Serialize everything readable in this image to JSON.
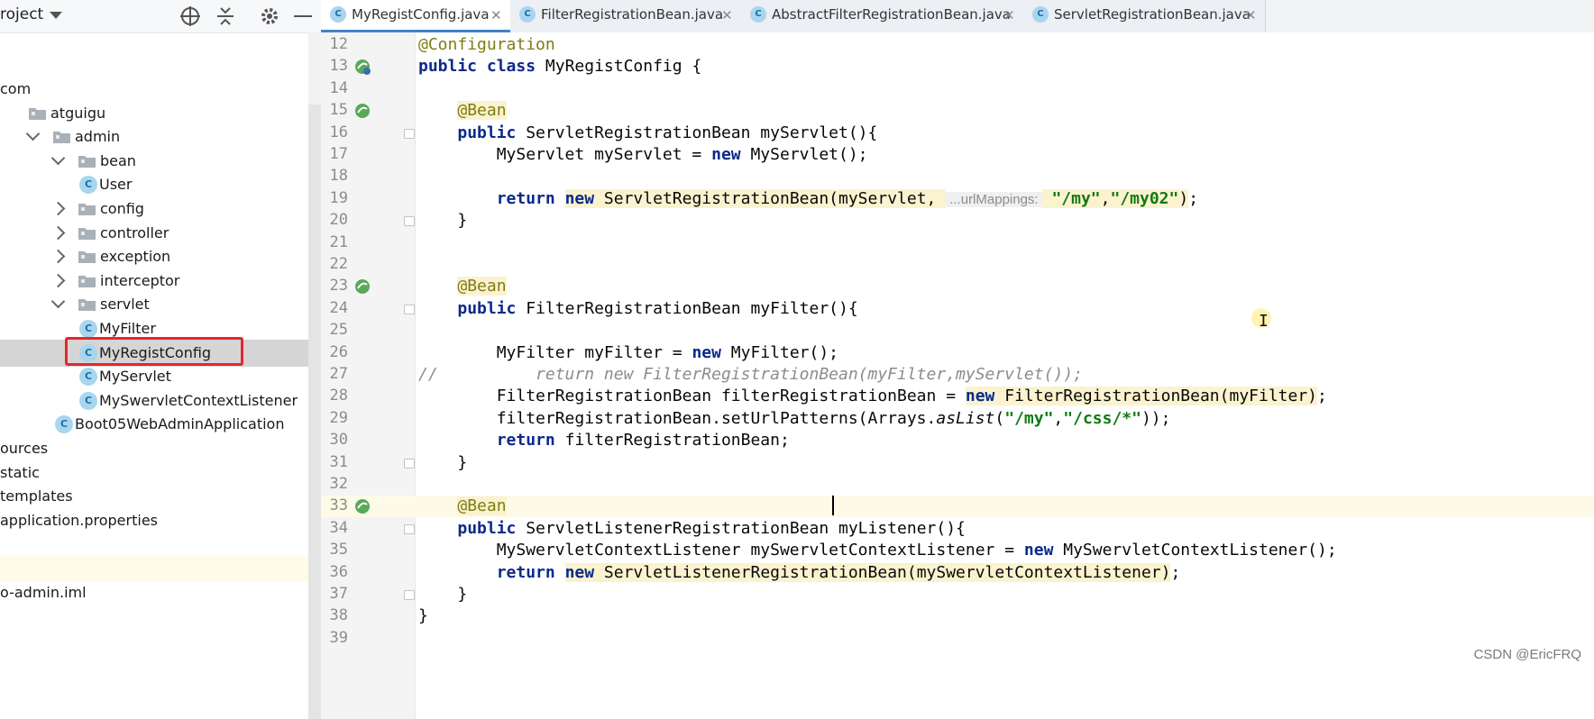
{
  "project_panel": {
    "title": "roject",
    "tree": [
      {
        "label": "com",
        "type": "text",
        "indent": 0
      },
      {
        "label": "atguigu",
        "type": "folder",
        "indent": 1
      },
      {
        "label": "admin",
        "type": "folder",
        "indent": 2,
        "expanded": true
      },
      {
        "label": "bean",
        "type": "folder",
        "indent": 3,
        "expanded": true
      },
      {
        "label": "User",
        "type": "class",
        "indent": 4
      },
      {
        "label": "config",
        "type": "folder",
        "indent": 3,
        "expanded": false
      },
      {
        "label": "controller",
        "type": "folder",
        "indent": 3,
        "expanded": false
      },
      {
        "label": "exception",
        "type": "folder",
        "indent": 3,
        "expanded": false
      },
      {
        "label": "interceptor",
        "type": "folder",
        "indent": 3,
        "expanded": false
      },
      {
        "label": "servlet",
        "type": "folder",
        "indent": 3,
        "expanded": true
      },
      {
        "label": "MyFilter",
        "type": "class",
        "indent": 4
      },
      {
        "label": "MyRegistConfig",
        "type": "class",
        "indent": 4,
        "selected": true
      },
      {
        "label": "MyServlet",
        "type": "class",
        "indent": 4
      },
      {
        "label": "MySwervletContextListener",
        "type": "class",
        "indent": 4
      },
      {
        "label": "Boot05WebAdminApplication",
        "type": "app",
        "indent": 3
      },
      {
        "label": "ources",
        "type": "text",
        "indent": 0
      },
      {
        "label": "static",
        "type": "text",
        "indent": 0
      },
      {
        "label": "templates",
        "type": "text",
        "indent": 0
      },
      {
        "label": "application.properties",
        "type": "text",
        "indent": 0
      },
      {
        "label": "",
        "type": "blank",
        "indent": 0
      },
      {
        "label": "",
        "type": "highlight",
        "indent": 0
      },
      {
        "label": "o-admin.iml",
        "type": "text",
        "indent": 0
      }
    ]
  },
  "tabs": [
    {
      "label": "MyRegistConfig.java",
      "active": true
    },
    {
      "label": "FilterRegistrationBean.java",
      "active": false
    },
    {
      "label": "AbstractFilterRegistrationBean.java",
      "active": false
    },
    {
      "label": "ServletRegistrationBean.java",
      "active": false
    }
  ],
  "editor": {
    "lines": [
      {
        "n": "12",
        "segs": [
          [
            "ann",
            "@Configuration"
          ]
        ]
      },
      {
        "n": "13",
        "icon": "bean-config",
        "segs": [
          [
            "kw",
            "public class "
          ],
          [
            "",
            "MyRegistConfig {"
          ]
        ]
      },
      {
        "n": "14",
        "segs": []
      },
      {
        "n": "15",
        "icon": "bean",
        "segs": [
          [
            "",
            "    "
          ],
          [
            "annbg",
            "@Bean"
          ]
        ]
      },
      {
        "n": "16",
        "fold": true,
        "segs": [
          [
            "",
            "    "
          ],
          [
            "kw",
            "public "
          ],
          [
            "",
            "ServletRegistrationBean myServlet(){"
          ]
        ]
      },
      {
        "n": "17",
        "segs": [
          [
            "",
            "        MyServlet myServlet = "
          ],
          [
            "kw",
            "new "
          ],
          [
            "",
            "MyServlet();"
          ]
        ]
      },
      {
        "n": "18",
        "segs": []
      },
      {
        "n": "19",
        "segs": [
          [
            "",
            "        "
          ],
          [
            "kw",
            "return "
          ],
          [
            "kwbg",
            "new "
          ],
          [
            "hlbg",
            "ServletRegistrationBean(myServlet, "
          ],
          [
            "hint",
            "...urlMappings:"
          ],
          [
            "hlbg",
            " "
          ],
          [
            "strbg",
            "\"/my\""
          ],
          [
            "hlbg",
            ","
          ],
          [
            "strbg",
            "\"/my02\""
          ],
          [
            "hlbg",
            ")"
          ],
          [
            "",
            ";"
          ]
        ]
      },
      {
        "n": "20",
        "fold": true,
        "segs": [
          [
            "",
            "    }"
          ]
        ]
      },
      {
        "n": "21",
        "segs": []
      },
      {
        "n": "22",
        "segs": []
      },
      {
        "n": "23",
        "icon": "bean",
        "segs": [
          [
            "",
            "    "
          ],
          [
            "annbg",
            "@Bean"
          ]
        ]
      },
      {
        "n": "24",
        "fold": true,
        "segs": [
          [
            "",
            "    "
          ],
          [
            "kw",
            "public "
          ],
          [
            "",
            "FilterRegistrationBean myFilter(){"
          ]
        ]
      },
      {
        "n": "25",
        "segs": []
      },
      {
        "n": "26",
        "segs": [
          [
            "",
            "        MyFilter myFilter = "
          ],
          [
            "kw",
            "new "
          ],
          [
            "",
            "MyFilter();"
          ]
        ]
      },
      {
        "n": "27",
        "segs": [
          [
            "cmt",
            "//          return new FilterRegistrationBean(myFilter,myServlet());"
          ]
        ]
      },
      {
        "n": "28",
        "segs": [
          [
            "",
            "        FilterRegistrationBean filterRegistrationBean = "
          ],
          [
            "kwbg",
            "new "
          ],
          [
            "hlbg",
            "FilterRegistrationBean(myFilter)"
          ],
          [
            "",
            ";"
          ]
        ]
      },
      {
        "n": "29",
        "segs": [
          [
            "",
            "        filterRegistrationBean.setUrlPatterns(Arrays."
          ],
          [
            "it",
            "asList"
          ],
          [
            "",
            "("
          ],
          [
            "str",
            "\"/my\""
          ],
          [
            "",
            ","
          ],
          [
            "str",
            "\"/css/*\""
          ],
          [
            "",
            "));"
          ]
        ]
      },
      {
        "n": "30",
        "segs": [
          [
            "",
            "        "
          ],
          [
            "kw",
            "return "
          ],
          [
            "",
            "filterRegistrationBean;"
          ]
        ]
      },
      {
        "n": "31",
        "fold": true,
        "segs": [
          [
            "",
            "    }"
          ]
        ]
      },
      {
        "n": "32",
        "segs": []
      },
      {
        "n": "33",
        "icon": "bean",
        "current": true,
        "segs": [
          [
            "",
            "    "
          ],
          [
            "annbg",
            "@Bean"
          ]
        ]
      },
      {
        "n": "34",
        "fold": true,
        "segs": [
          [
            "",
            "    "
          ],
          [
            "kw",
            "public "
          ],
          [
            "",
            "ServletListenerRegistrationBean myListener(){"
          ]
        ]
      },
      {
        "n": "35",
        "segs": [
          [
            "",
            "        MySwervletContextListener mySwervletContextListener = "
          ],
          [
            "kw",
            "new "
          ],
          [
            "",
            "MySwervletContextListener();"
          ]
        ]
      },
      {
        "n": "36",
        "segs": [
          [
            "",
            "        "
          ],
          [
            "kw",
            "return "
          ],
          [
            "kwbg",
            "new "
          ],
          [
            "hlbg",
            "ServletListenerRegistrationBean(mySwervletContextListener)"
          ],
          [
            "",
            ";"
          ]
        ]
      },
      {
        "n": "37",
        "fold": true,
        "segs": [
          [
            "",
            "    }"
          ]
        ]
      },
      {
        "n": "38",
        "segs": [
          [
            "",
            "}"
          ]
        ]
      },
      {
        "n": "39",
        "segs": []
      }
    ]
  },
  "watermark": "CSDN @EricFRQ",
  "colors": {
    "accent": "#4083c9",
    "selection_border": "#e6262b",
    "annotation": "#7d7d14",
    "keyword": "#0a2a8a",
    "string": "#107a10"
  }
}
